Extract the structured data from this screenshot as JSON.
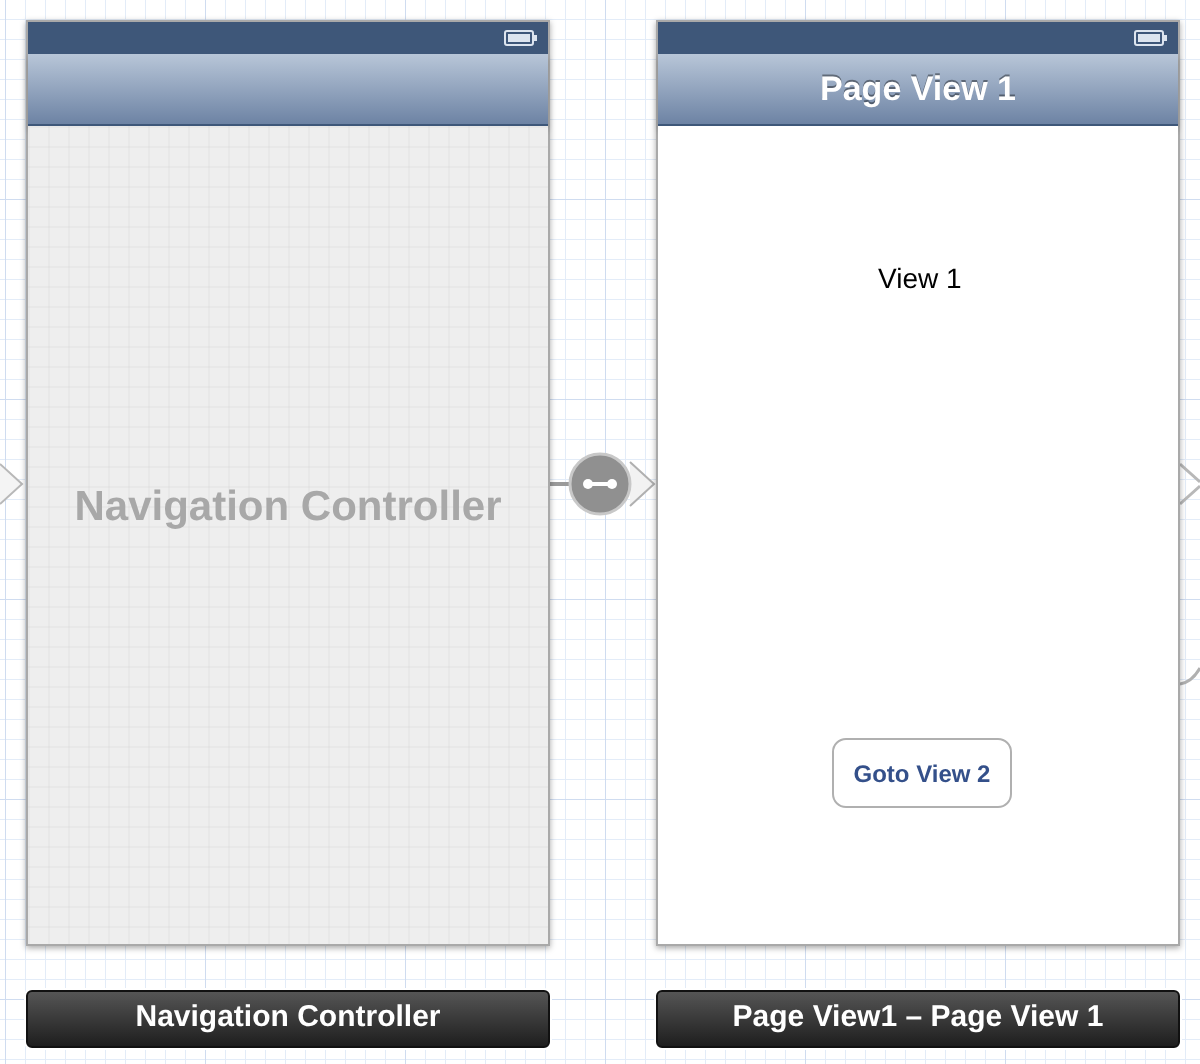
{
  "scenes": [
    {
      "kind": "navigation",
      "placeholder_text": "Navigation Controller",
      "label": "Navigation Controller"
    },
    {
      "kind": "view",
      "nav_title": "Page View 1",
      "text": "View 1",
      "button": "Goto View 2",
      "label": "Page View1 – Page View 1"
    }
  ]
}
